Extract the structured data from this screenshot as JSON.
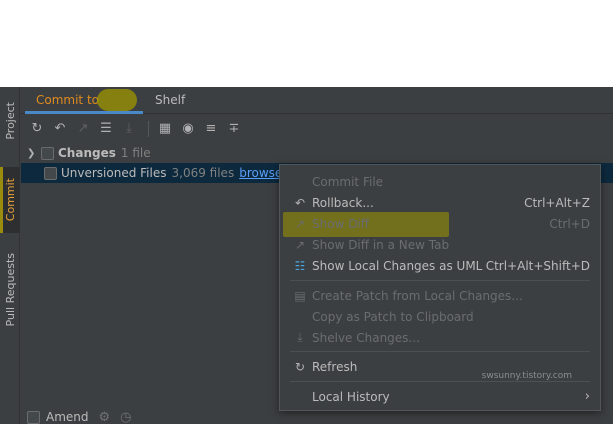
{
  "left_strip": {
    "project_label": "Project",
    "commit_label": "Commit",
    "pull_requests_label": "Pull Requests"
  },
  "tabs": [
    {
      "label": "Commit to"
    },
    {
      "label": "Shelf"
    }
  ],
  "toolbar": {
    "icons": [
      "refresh-icon",
      "rollback-icon",
      "show-diff-icon",
      "commit-message-icon",
      "shelve-icon",
      "group-by-icon",
      "view-options-icon",
      "expand-all-icon",
      "collapse-all-icon"
    ]
  },
  "tree": {
    "changes_label": "Changes",
    "changes_count": "1 file",
    "unversioned_label": "Unversioned Files",
    "unversioned_count": "3,069 files",
    "browse_link": "browse"
  },
  "amend": {
    "label": "Amend"
  },
  "context_menu": {
    "items": [
      {
        "label": "Commit File",
        "shortcut": "",
        "enabled": false
      },
      {
        "label": "Rollback...",
        "shortcut": "Ctrl+Alt+Z",
        "enabled": true
      },
      {
        "label": "Show Diff",
        "shortcut": "Ctrl+D",
        "enabled": false
      },
      {
        "label": "Show Diff in a New Tab",
        "shortcut": "",
        "enabled": false
      },
      {
        "label": "Show Local Changes as UML",
        "shortcut": "Ctrl+Alt+Shift+D",
        "enabled": true
      },
      {
        "label": "Create Patch from Local Changes...",
        "shortcut": "",
        "enabled": false
      },
      {
        "label": "Copy as Patch to Clipboard",
        "shortcut": "",
        "enabled": false
      },
      {
        "label": "Shelve Changes...",
        "shortcut": "",
        "enabled": false
      },
      {
        "label": "Refresh",
        "shortcut": "",
        "enabled": true
      },
      {
        "label": "Local History",
        "shortcut": "",
        "enabled": true
      }
    ],
    "watermark": "swsunny.tistory.com"
  },
  "colors": {
    "panel_bg": "#3c3f41",
    "selection_bg": "#0d293e",
    "commit_tab_text": "#e08b1e",
    "highlight": "#9f9700",
    "link": "#589df6"
  }
}
